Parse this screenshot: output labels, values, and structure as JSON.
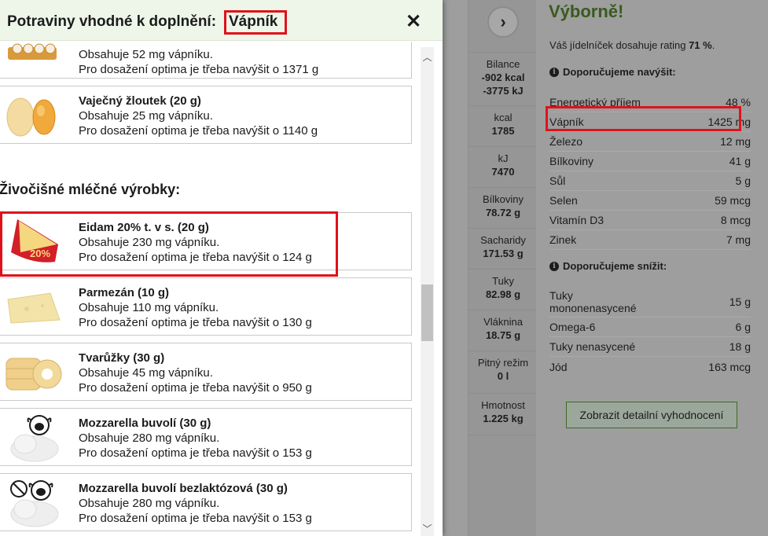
{
  "modal": {
    "title_prefix": "Potraviny vhodné k doplnění:",
    "nutrient": "Vápník",
    "close_label": "✕",
    "category": "Živočišné mléčné výrobky:",
    "items_top": [
      {
        "name": "",
        "contains": "Obsahuje 52 mg vápníku.",
        "needed": "Pro dosažení optima je třeba navýšit o 1371 g",
        "icon": "crackers-icon"
      },
      {
        "name": "Vaječný žloutek (20 g)",
        "contains": "Obsahuje 25 mg vápníku.",
        "needed": "Pro dosažení optima je třeba navýšit o 1140 g",
        "icon": "egg-yolk-icon"
      }
    ],
    "items": [
      {
        "name": "Eidam 20% t. v s. (20 g)",
        "contains": "Obsahuje 230 mg vápníku.",
        "needed": "Pro dosažení optima je třeba navýšit o 124 g",
        "icon": "eidam-cheese-icon",
        "badge": "20%"
      },
      {
        "name": "Parmezán (10 g)",
        "contains": "Obsahuje 110 mg vápníku.",
        "needed": "Pro dosažení optima je třeba navýšit o 130 g",
        "icon": "parmesan-icon"
      },
      {
        "name": "Tvarůžky (30 g)",
        "contains": "Obsahuje 45 mg vápníku.",
        "needed": "Pro dosažení optima je třeba navýšit o 950 g",
        "icon": "tvaruzky-icon"
      },
      {
        "name": "Mozzarella buvolí (30 g)",
        "contains": "Obsahuje 280 mg vápníku.",
        "needed": "Pro dosažení optima je třeba navýšit o 153 g",
        "icon": "mozzarella-buffalo-icon"
      },
      {
        "name": "Mozzarella buvolí bezlaktózová (30 g)",
        "contains": "Obsahuje 280 mg vápníku.",
        "needed": "Pro dosažení optima je třeba navýšit o 153 g",
        "icon": "mozzarella-lactose-free-icon"
      }
    ]
  },
  "stats": {
    "arrow": "›",
    "items": [
      {
        "label": "Bilance",
        "value": "-902 kcal",
        "value2": "-3775 kJ"
      },
      {
        "label": "kcal",
        "value": "1785"
      },
      {
        "label": "kJ",
        "value": "7470"
      },
      {
        "label": "Bílkoviny",
        "value": "78.72 g"
      },
      {
        "label": "Sacharidy",
        "value": "171.53 g"
      },
      {
        "label": "Tuky",
        "value": "82.98 g"
      },
      {
        "label": "Vláknina",
        "value": "18.75 g"
      },
      {
        "label": "Pitný režim",
        "value": "0 l"
      },
      {
        "label": "Hmotnost",
        "value": "1.225 kg"
      }
    ]
  },
  "summary": {
    "title": "Výborně!",
    "rating_text": "Váš jídelníček dosahuje rating",
    "rating_value": "71 %",
    "increase_head": "Doporučujeme navýšit:",
    "increase": [
      {
        "name": "Energetický příjem",
        "value": "48 %"
      },
      {
        "name": "Vápník",
        "value": "1425 mg"
      },
      {
        "name": "Železo",
        "value": "12 mg"
      },
      {
        "name": "Bílkoviny",
        "value": "41 g"
      },
      {
        "name": "Sůl",
        "value": "5 g"
      },
      {
        "name": "Selen",
        "value": "59 mcg"
      },
      {
        "name": "Vitamín D3",
        "value": "8 mcg"
      },
      {
        "name": "Zinek",
        "value": "7 mg"
      }
    ],
    "decrease_head": "Doporučujeme snížit:",
    "decrease": [
      {
        "name": "Tuky mononenasycené",
        "value": "15 g"
      },
      {
        "name": "Omega-6",
        "value": "6 g"
      },
      {
        "name": "Tuky nenasycené",
        "value": "18 g"
      },
      {
        "name": "Jód",
        "value": "163 mcg"
      }
    ],
    "detail_button": "Zobrazit detailní vyhodnocení"
  },
  "colors": {
    "highlight": "#e0111a",
    "header_bg": "#eef6ea",
    "brand_green": "#3f6a23"
  }
}
